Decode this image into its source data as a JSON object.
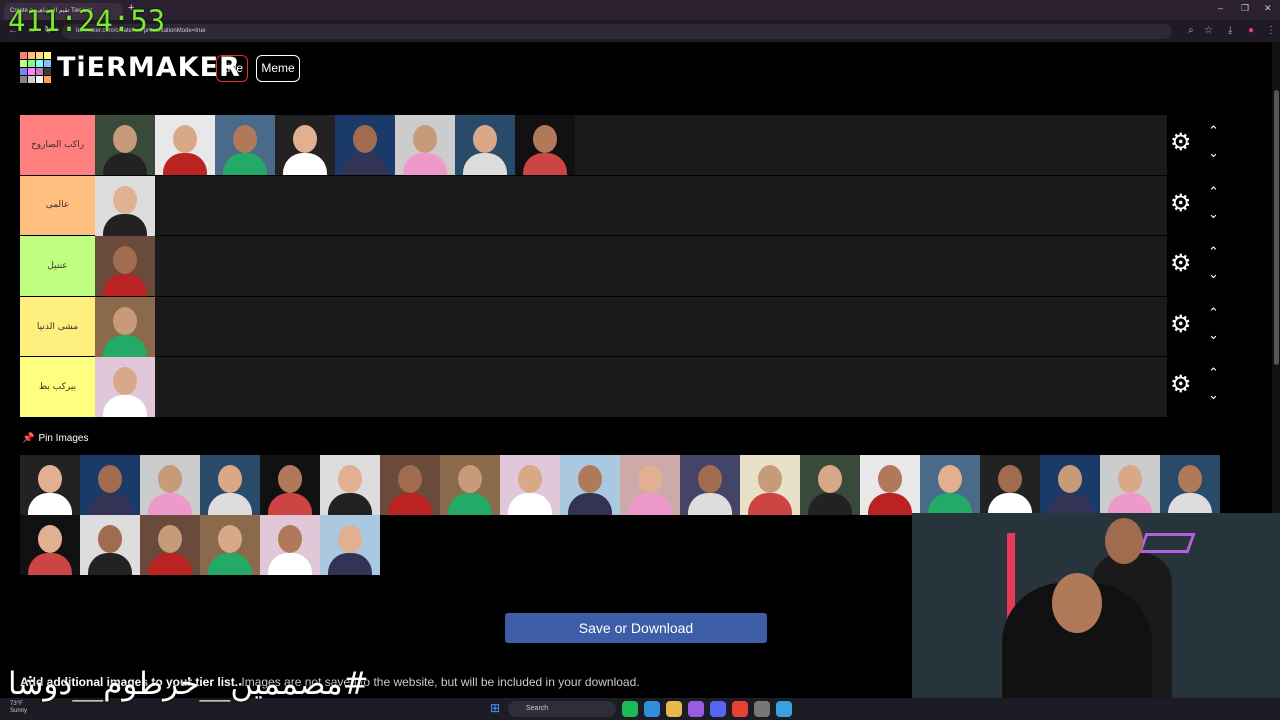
{
  "browser": {
    "tab_title": "Create a تقيم المشاهير Tier List",
    "new_tab": "+",
    "url": "tiermaker.com/create/... ?presentationMode=true",
    "window_controls": [
      "–",
      "❐",
      "✕"
    ]
  },
  "overlay": {
    "timer": "411:24:53",
    "watermark": "#مصممين__خرطوم__دوشا"
  },
  "header": {
    "logo_text": "TiERMAKER",
    "logo_colors": [
      "#ff7f7f",
      "#ffbf7f",
      "#ffdf7f",
      "#ffff7f",
      "#bfff7f",
      "#7fff7f",
      "#7fffff",
      "#7fbfff",
      "#7f7fff",
      "#ff7fff",
      "#bf7fbf",
      "#3b3b3b",
      "#858585",
      "#cfcfcf",
      "#f7f7f7",
      "#ff9f50"
    ],
    "live_label": "Live",
    "meme_label": "Meme"
  },
  "tiers": [
    {
      "label": "راكب الصاروخ",
      "color": "#ff7f7f",
      "items": 8
    },
    {
      "label": "عالمى",
      "color": "#ffbf7f",
      "items": 1
    },
    {
      "label": "عنتيل",
      "color": "#bfff7f",
      "items": 1
    },
    {
      "label": "مشى الدنيا",
      "color": "#ffef7f",
      "items": 1
    },
    {
      "label": "بيركب بط",
      "color": "#ffff7f",
      "items": 1
    }
  ],
  "tier_controls": {
    "gear_icon": "⚙",
    "up_icon": "⌃",
    "down_icon": "⌄"
  },
  "pin": {
    "label": "Pin Images"
  },
  "pool": {
    "count": 26
  },
  "save_button": "Save or Download",
  "note": {
    "bold": "Add additional images to your tier list.",
    "rest": " Images are not saved to the website, but will be included in your download."
  },
  "taskbar": {
    "weather_temp": "73°F",
    "weather_desc": "Sunny",
    "search_placeholder": "Search"
  }
}
